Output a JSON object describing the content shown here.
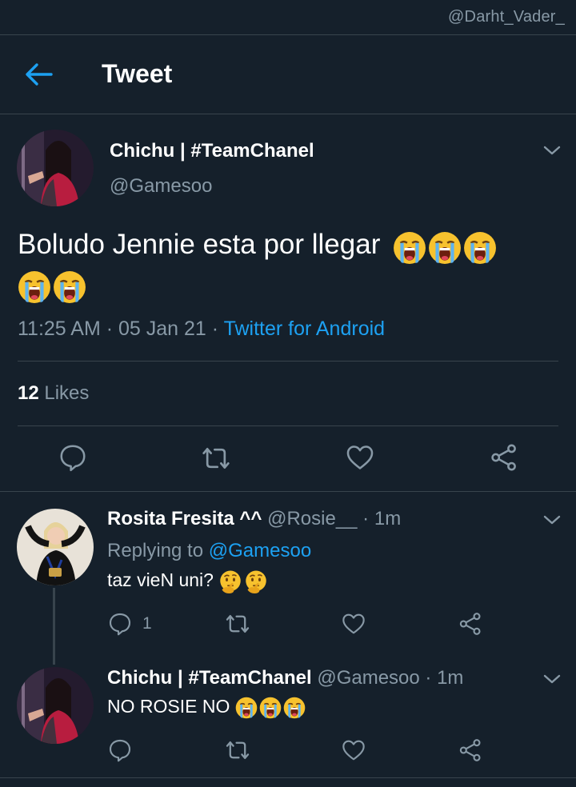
{
  "watermark": "@Darht_Vader_",
  "header": {
    "title": "Tweet",
    "back_icon": "arrow-left-icon",
    "accent": "#1da1f2"
  },
  "main_tweet": {
    "name": "Chichu | #TeamChanel",
    "handle": "@Gamesoo",
    "text": "Boludo Jennie esta por llegar",
    "emoji": "loudly-crying-face x5",
    "time": "11:25 AM · 05 Jan 21 ·",
    "source": "Twitter for Android",
    "likes_count": "12",
    "likes_label": "Likes"
  },
  "reply1": {
    "name": "Rosita Fresita ^^",
    "handle": "@Rosie__ · 1m",
    "replying_prefix": "Replying to",
    "replying_to": "@Gamesoo",
    "text": "taz vieN uni?",
    "emoji": "thinking-face x2",
    "reply_count": "1"
  },
  "reply2": {
    "name": "Chichu | #TeamChanel",
    "handle": "@Gamesoo · 1m",
    "text": "NO ROSIE NO",
    "emoji": "loudly-crying-face x3"
  },
  "colors": {
    "background": "#15202b",
    "divider": "#38444d",
    "secondary": "#8899a6",
    "link": "#1da1f2"
  }
}
